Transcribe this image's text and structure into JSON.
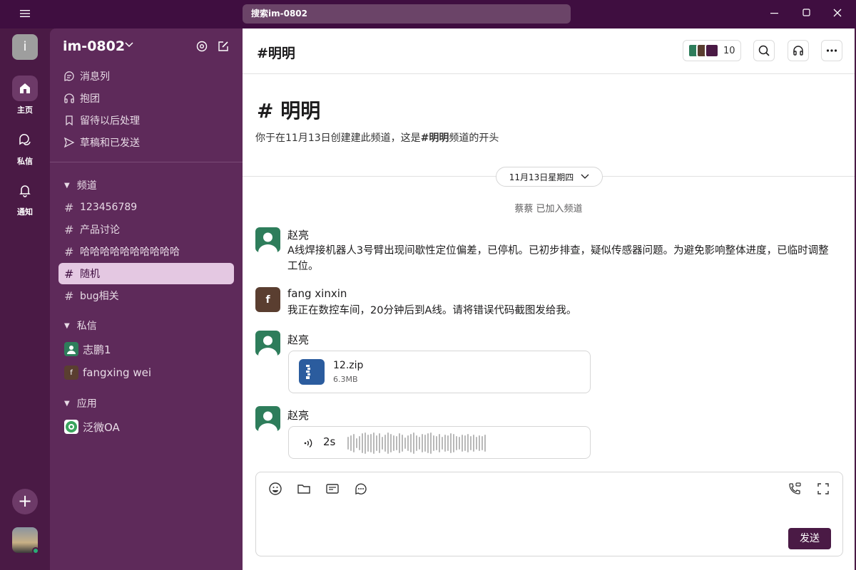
{
  "titlebar": {
    "search_placeholder": "搜索im-0802"
  },
  "rail": {
    "workspace_initial": "i",
    "items": [
      {
        "label": "主页",
        "icon": "home-icon"
      },
      {
        "label": "私信",
        "icon": "dm-icon"
      },
      {
        "label": "通知",
        "icon": "bell-icon"
      }
    ]
  },
  "sidebar": {
    "workspace_name": "im-0802",
    "nav": [
      {
        "label": "消息列",
        "icon": "threads-icon"
      },
      {
        "label": "抱团",
        "icon": "headphones-icon"
      },
      {
        "label": "留待以后处理",
        "icon": "bookmark-icon"
      },
      {
        "label": "草稿和已发送",
        "icon": "send-icon"
      }
    ],
    "channels_heading": "频道",
    "channels": [
      {
        "name": "123456789"
      },
      {
        "name": "产品讨论"
      },
      {
        "name": "哈哈哈哈哈哈哈哈哈哈"
      },
      {
        "name": "随机",
        "active": true
      },
      {
        "name": "bug相关"
      }
    ],
    "dms_heading": "私信",
    "dms": [
      {
        "name": "志鹏1",
        "avatar": "person-icon"
      },
      {
        "name": "fangxing wei",
        "avatar": "f"
      }
    ],
    "apps_heading": "应用",
    "apps": [
      {
        "name": "泛微OA",
        "icon": "app-logo-icon"
      }
    ]
  },
  "header": {
    "channel_title": "#明明",
    "member_count": "10"
  },
  "intro": {
    "title": "# 明明",
    "text_before": "你于在11月13日创建建此频道，这是",
    "text_bold": "#明明",
    "text_after": "频道的开头"
  },
  "date_divider": "11月13日星期四",
  "system_message": "蔡蔡 已加入频道",
  "messages": [
    {
      "author": "赵亮",
      "text": "A线焊接机器人3号臂出现间歇性定位偏差，已停机。已初步排查，疑似传感器问题。为避免影响整体进度，已临时调整工位。"
    },
    {
      "author": "fang xinxin",
      "avatar_letter": "f",
      "text": "我正在数控车间，20分钟后到A线。请将错误代码截图发给我。"
    },
    {
      "author": "赵亮",
      "file": {
        "name": "12.zip",
        "size": "6.3MB"
      }
    },
    {
      "author": "赵亮",
      "voice": {
        "duration": "2s"
      }
    }
  ],
  "composer": {
    "send_label": "发送"
  },
  "colors": {
    "rail_bg": "#4a1a45",
    "sidebar_bg": "#5e2a5a",
    "active_channel_bg": "#e4c8e2",
    "send_button": "#4a1a45"
  }
}
